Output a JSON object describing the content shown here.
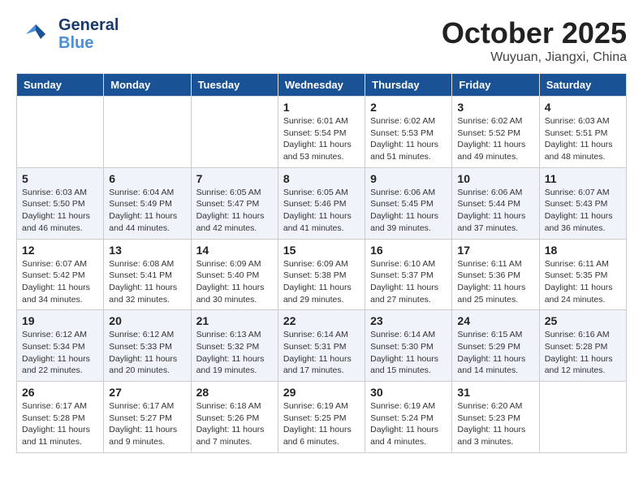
{
  "logo": {
    "line1": "General",
    "line2": "Blue"
  },
  "title": "October 2025",
  "subtitle": "Wuyuan, Jiangxi, China",
  "weekdays": [
    "Sunday",
    "Monday",
    "Tuesday",
    "Wednesday",
    "Thursday",
    "Friday",
    "Saturday"
  ],
  "weeks": [
    [
      {
        "day": "",
        "info": ""
      },
      {
        "day": "",
        "info": ""
      },
      {
        "day": "",
        "info": ""
      },
      {
        "day": "1",
        "info": "Sunrise: 6:01 AM\nSunset: 5:54 PM\nDaylight: 11 hours and 53 minutes."
      },
      {
        "day": "2",
        "info": "Sunrise: 6:02 AM\nSunset: 5:53 PM\nDaylight: 11 hours and 51 minutes."
      },
      {
        "day": "3",
        "info": "Sunrise: 6:02 AM\nSunset: 5:52 PM\nDaylight: 11 hours and 49 minutes."
      },
      {
        "day": "4",
        "info": "Sunrise: 6:03 AM\nSunset: 5:51 PM\nDaylight: 11 hours and 48 minutes."
      }
    ],
    [
      {
        "day": "5",
        "info": "Sunrise: 6:03 AM\nSunset: 5:50 PM\nDaylight: 11 hours and 46 minutes."
      },
      {
        "day": "6",
        "info": "Sunrise: 6:04 AM\nSunset: 5:49 PM\nDaylight: 11 hours and 44 minutes."
      },
      {
        "day": "7",
        "info": "Sunrise: 6:05 AM\nSunset: 5:47 PM\nDaylight: 11 hours and 42 minutes."
      },
      {
        "day": "8",
        "info": "Sunrise: 6:05 AM\nSunset: 5:46 PM\nDaylight: 11 hours and 41 minutes."
      },
      {
        "day": "9",
        "info": "Sunrise: 6:06 AM\nSunset: 5:45 PM\nDaylight: 11 hours and 39 minutes."
      },
      {
        "day": "10",
        "info": "Sunrise: 6:06 AM\nSunset: 5:44 PM\nDaylight: 11 hours and 37 minutes."
      },
      {
        "day": "11",
        "info": "Sunrise: 6:07 AM\nSunset: 5:43 PM\nDaylight: 11 hours and 36 minutes."
      }
    ],
    [
      {
        "day": "12",
        "info": "Sunrise: 6:07 AM\nSunset: 5:42 PM\nDaylight: 11 hours and 34 minutes."
      },
      {
        "day": "13",
        "info": "Sunrise: 6:08 AM\nSunset: 5:41 PM\nDaylight: 11 hours and 32 minutes."
      },
      {
        "day": "14",
        "info": "Sunrise: 6:09 AM\nSunset: 5:40 PM\nDaylight: 11 hours and 30 minutes."
      },
      {
        "day": "15",
        "info": "Sunrise: 6:09 AM\nSunset: 5:38 PM\nDaylight: 11 hours and 29 minutes."
      },
      {
        "day": "16",
        "info": "Sunrise: 6:10 AM\nSunset: 5:37 PM\nDaylight: 11 hours and 27 minutes."
      },
      {
        "day": "17",
        "info": "Sunrise: 6:11 AM\nSunset: 5:36 PM\nDaylight: 11 hours and 25 minutes."
      },
      {
        "day": "18",
        "info": "Sunrise: 6:11 AM\nSunset: 5:35 PM\nDaylight: 11 hours and 24 minutes."
      }
    ],
    [
      {
        "day": "19",
        "info": "Sunrise: 6:12 AM\nSunset: 5:34 PM\nDaylight: 11 hours and 22 minutes."
      },
      {
        "day": "20",
        "info": "Sunrise: 6:12 AM\nSunset: 5:33 PM\nDaylight: 11 hours and 20 minutes."
      },
      {
        "day": "21",
        "info": "Sunrise: 6:13 AM\nSunset: 5:32 PM\nDaylight: 11 hours and 19 minutes."
      },
      {
        "day": "22",
        "info": "Sunrise: 6:14 AM\nSunset: 5:31 PM\nDaylight: 11 hours and 17 minutes."
      },
      {
        "day": "23",
        "info": "Sunrise: 6:14 AM\nSunset: 5:30 PM\nDaylight: 11 hours and 15 minutes."
      },
      {
        "day": "24",
        "info": "Sunrise: 6:15 AM\nSunset: 5:29 PM\nDaylight: 11 hours and 14 minutes."
      },
      {
        "day": "25",
        "info": "Sunrise: 6:16 AM\nSunset: 5:28 PM\nDaylight: 11 hours and 12 minutes."
      }
    ],
    [
      {
        "day": "26",
        "info": "Sunrise: 6:17 AM\nSunset: 5:28 PM\nDaylight: 11 hours and 11 minutes."
      },
      {
        "day": "27",
        "info": "Sunrise: 6:17 AM\nSunset: 5:27 PM\nDaylight: 11 hours and 9 minutes."
      },
      {
        "day": "28",
        "info": "Sunrise: 6:18 AM\nSunset: 5:26 PM\nDaylight: 11 hours and 7 minutes."
      },
      {
        "day": "29",
        "info": "Sunrise: 6:19 AM\nSunset: 5:25 PM\nDaylight: 11 hours and 6 minutes."
      },
      {
        "day": "30",
        "info": "Sunrise: 6:19 AM\nSunset: 5:24 PM\nDaylight: 11 hours and 4 minutes."
      },
      {
        "day": "31",
        "info": "Sunrise: 6:20 AM\nSunset: 5:23 PM\nDaylight: 11 hours and 3 minutes."
      },
      {
        "day": "",
        "info": ""
      }
    ]
  ]
}
